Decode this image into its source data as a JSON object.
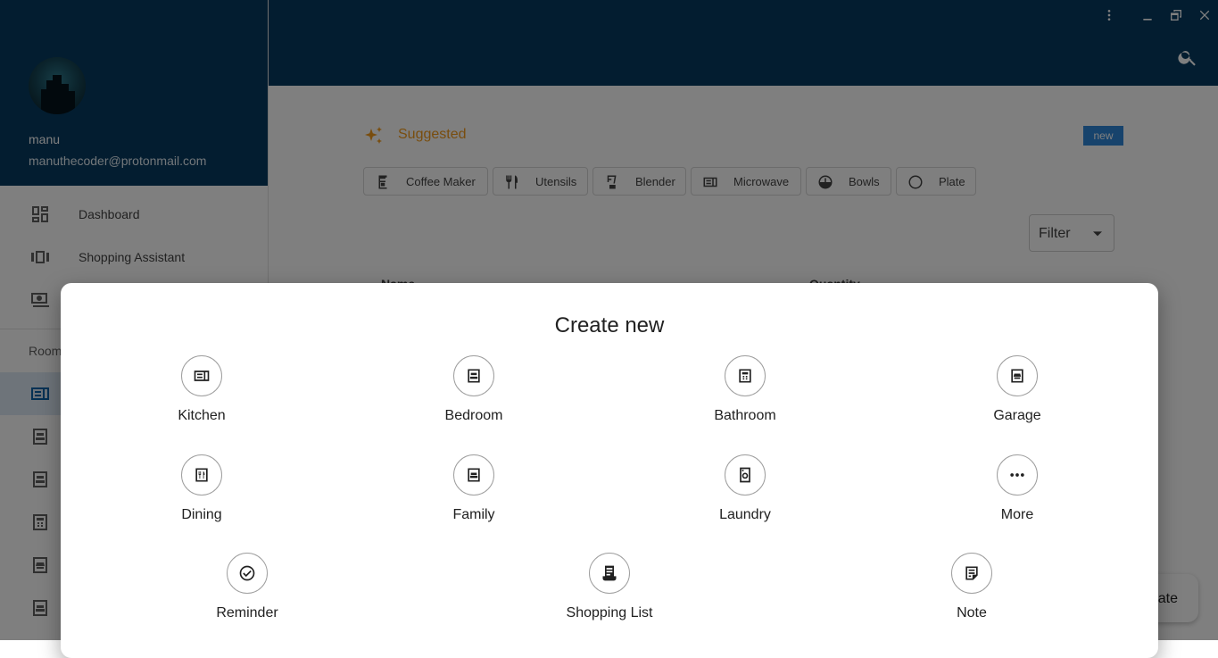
{
  "window": {
    "menu_icon": "more-vert-icon",
    "minimize_icon": "minimize-icon",
    "restore_icon": "restore-icon",
    "close_icon": "close-icon"
  },
  "user": {
    "name": "manu",
    "email": "manuthecoder@protonmail.com"
  },
  "nav": [
    {
      "label": "Dashboard",
      "icon": "dashboard-icon"
    },
    {
      "label": "Shopping Assistant",
      "icon": "shopping-assistant-icon"
    },
    {
      "label": "",
      "icon": "finances-icon"
    }
  ],
  "rooms": {
    "label": "Room",
    "items": [
      {
        "icon": "kitchen-icon",
        "active": true
      },
      {
        "icon": "bedroom-icon",
        "active": false
      },
      {
        "icon": "bedroom-icon",
        "active": false
      },
      {
        "icon": "bathroom-icon",
        "active": false
      },
      {
        "icon": "garage-icon",
        "active": false
      },
      {
        "icon": "family-icon",
        "active": false
      }
    ]
  },
  "main": {
    "suggested": {
      "title": "Suggested",
      "badge": "new"
    },
    "chips": [
      {
        "label": "Coffee Maker",
        "icon": "coffee-maker-icon"
      },
      {
        "label": "Utensils",
        "icon": "utensils-icon"
      },
      {
        "label": "Blender",
        "icon": "blender-icon"
      },
      {
        "label": "Microwave",
        "icon": "microwave-icon"
      },
      {
        "label": "Bowls",
        "icon": "bowls-icon"
      },
      {
        "label": "Plate",
        "icon": "plate-icon"
      }
    ],
    "filter": {
      "label": "Filter"
    },
    "table_headers": [
      "Name",
      "Quantity"
    ],
    "fab_label": "Create"
  },
  "dialog": {
    "title": "Create new",
    "options": [
      {
        "label": "Kitchen",
        "icon": "kitchen-icon"
      },
      {
        "label": "Bedroom",
        "icon": "bedroom-icon"
      },
      {
        "label": "Bathroom",
        "icon": "bathroom-icon"
      },
      {
        "label": "Garage",
        "icon": "garage-icon"
      },
      {
        "label": "Dining",
        "icon": "dining-icon"
      },
      {
        "label": "Family",
        "icon": "family-icon"
      },
      {
        "label": "Laundry",
        "icon": "laundry-icon"
      },
      {
        "label": "More",
        "icon": "more-horiz-icon"
      },
      {
        "label": "Reminder",
        "icon": "reminder-check-icon"
      },
      {
        "label": "Shopping List",
        "icon": "receipt-icon"
      },
      {
        "label": "Note",
        "icon": "note-icon"
      }
    ]
  }
}
